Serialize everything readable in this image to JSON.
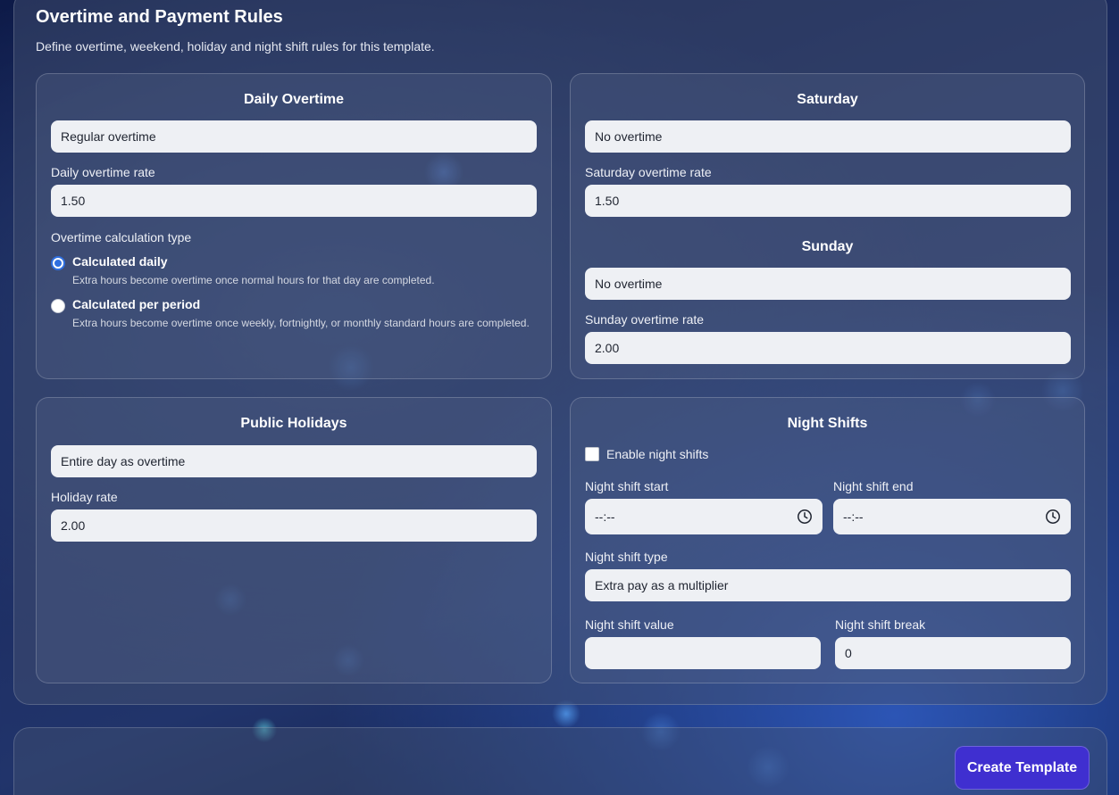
{
  "section": {
    "title": "Overtime and Payment Rules",
    "description": "Define overtime, weekend, holiday and night shift rules for this template."
  },
  "daily_overtime": {
    "title": "Daily Overtime",
    "mode_value": "Regular overtime",
    "rate_label": "Daily overtime rate",
    "rate_value": "1.50",
    "calc_type_label": "Overtime calculation type",
    "options": [
      {
        "label": "Calculated daily",
        "description": "Extra hours become overtime once normal hours for that day are completed.",
        "selected": true
      },
      {
        "label": "Calculated per period",
        "description": "Extra hours become overtime once weekly, fortnightly, or monthly standard hours are completed.",
        "selected": false
      }
    ]
  },
  "saturday": {
    "title": "Saturday",
    "mode_value": "No overtime",
    "rate_label": "Saturday overtime rate",
    "rate_value": "1.50"
  },
  "sunday": {
    "title": "Sunday",
    "mode_value": "No overtime",
    "rate_label": "Sunday overtime rate",
    "rate_value": "2.00"
  },
  "public_holidays": {
    "title": "Public Holidays",
    "mode_value": "Entire day as overtime",
    "rate_label": "Holiday rate",
    "rate_value": "2.00"
  },
  "night_shifts": {
    "title": "Night Shifts",
    "enable_label": "Enable night shifts",
    "enabled": false,
    "start_label": "Night shift start",
    "start_value": "--:--",
    "end_label": "Night shift end",
    "end_value": "--:--",
    "type_label": "Night shift type",
    "type_value": "Extra pay as a multiplier",
    "value_label": "Night shift value",
    "value_value": "",
    "break_label": "Night shift break",
    "break_value": "0"
  },
  "footer": {
    "create_label": "Create Template"
  },
  "icons": {
    "time_picker": "clock-icon"
  },
  "colors": {
    "accent_button": "#3f2fd0",
    "radio_selected": "#2f6fe0",
    "field_background": "#eef0f4"
  }
}
